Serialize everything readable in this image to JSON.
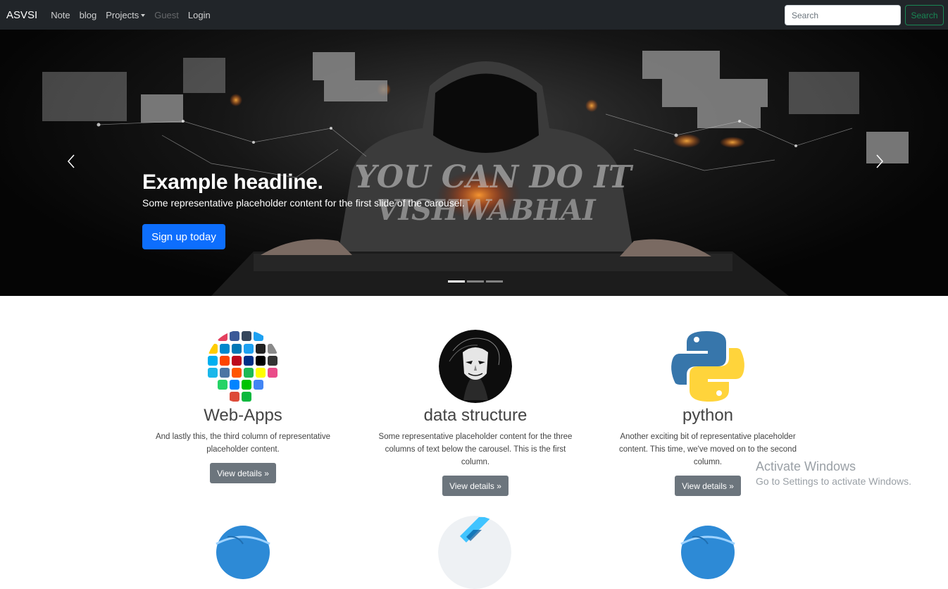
{
  "navbar": {
    "brand": "ASVSI",
    "links": [
      "Note",
      "blog",
      "Projects",
      "Guest",
      "Login"
    ],
    "search_placeholder": "Search",
    "search_button": "Search"
  },
  "carousel": {
    "headline": "Example headline.",
    "text": "Some representative placeholder content for the first slide of the carousel.",
    "button": "Sign up today",
    "overlay_line1": "YOU CAN DO IT",
    "overlay_line2": "VISHWABHAI",
    "slides": 3,
    "active_slide": 1
  },
  "columns": [
    {
      "title": "Web-Apps",
      "text": "And lastly this, the third column of representative placeholder content.",
      "button": "View details »",
      "image": "social-media-icons"
    },
    {
      "title": "data structure",
      "text": "Some representative placeholder content for the three columns of text below the carousel. This is the first column.",
      "button": "View details »",
      "image": "masked-figure"
    },
    {
      "title": "python",
      "text": "Another exciting bit of representative placeholder content. This time, we've moved on to the second column.",
      "button": "View details »",
      "image": "python-logo"
    }
  ],
  "watermark": {
    "line1": "Activate Windows",
    "line2": "Go to Settings to activate Windows."
  },
  "colors": {
    "navbar_bg": "#212529",
    "primary": "#0d6efd",
    "success": "#198754",
    "secondary": "#6c757d"
  }
}
